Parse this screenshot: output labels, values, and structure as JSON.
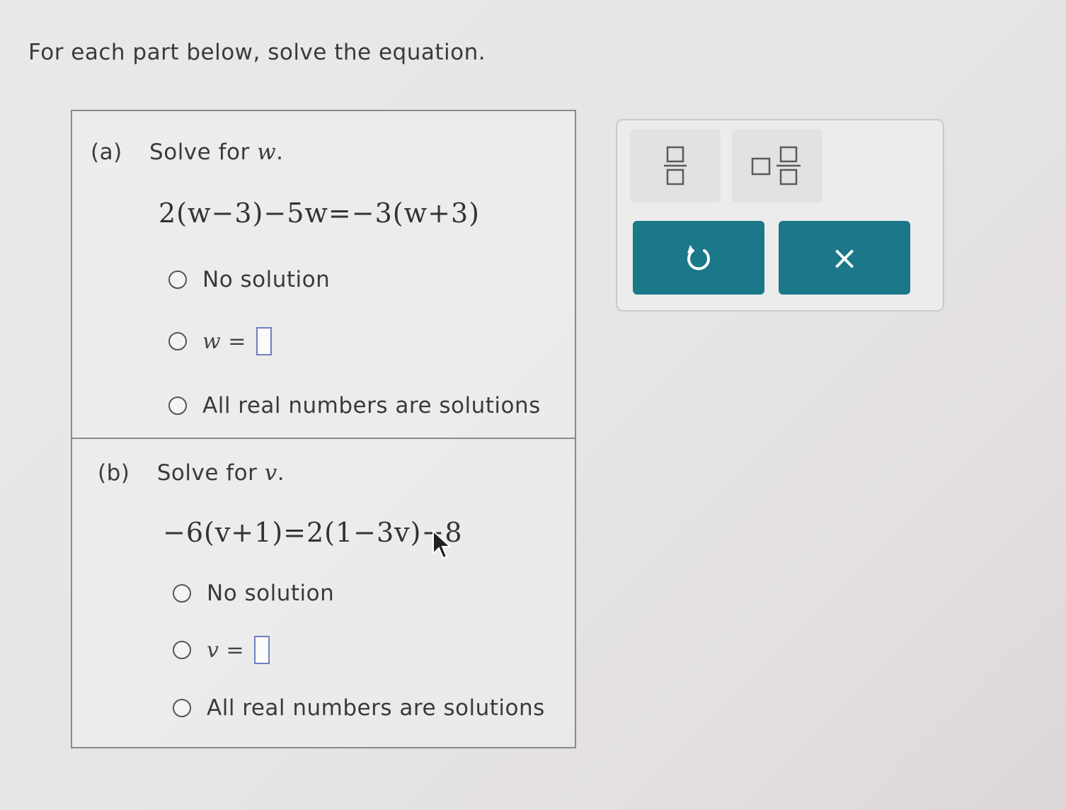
{
  "instruction": "For each part below, solve the equation.",
  "part_a": {
    "letter": "(a)",
    "prompt_prefix": "Solve for",
    "variable": "w",
    "prompt_suffix": ".",
    "equation": "2(w−3)−5w=−3(w+3)",
    "options": {
      "no_solution": "No solution",
      "value_label": "w =",
      "all_real": "All real numbers are solutions"
    }
  },
  "part_b": {
    "letter": "(b)",
    "prompt_prefix": "Solve for",
    "variable": "v",
    "prompt_suffix": ".",
    "equation": "−6(v+1)=2(1−3v)−8",
    "options": {
      "no_solution": "No solution",
      "value_label": "v =",
      "all_real": "All real numbers are solutions"
    }
  },
  "toolbar": {
    "fraction_icon": "fraction-icon",
    "mixed_number_icon": "mixed-number-icon",
    "undo_icon": "undo-icon",
    "clear_icon": "close-icon",
    "clear_symbol": "×"
  },
  "colors": {
    "action_button": "#1a7888",
    "answer_box_border": "#6f7fc0"
  }
}
